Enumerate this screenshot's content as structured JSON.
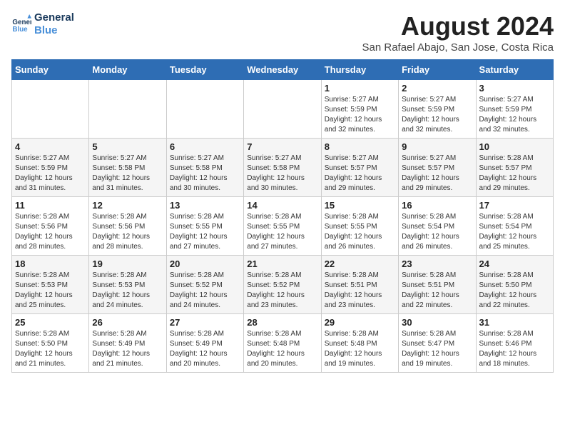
{
  "logo": {
    "line1": "General",
    "line2": "Blue"
  },
  "title": "August 2024",
  "subtitle": "San Rafael Abajo, San Jose, Costa Rica",
  "weekdays": [
    "Sunday",
    "Monday",
    "Tuesday",
    "Wednesday",
    "Thursday",
    "Friday",
    "Saturday"
  ],
  "weeks": [
    [
      {
        "day": "",
        "sunrise": "",
        "sunset": "",
        "daylight": ""
      },
      {
        "day": "",
        "sunrise": "",
        "sunset": "",
        "daylight": ""
      },
      {
        "day": "",
        "sunrise": "",
        "sunset": "",
        "daylight": ""
      },
      {
        "day": "",
        "sunrise": "",
        "sunset": "",
        "daylight": ""
      },
      {
        "day": "1",
        "sunrise": "5:27 AM",
        "sunset": "5:59 PM",
        "daylight": "12 hours and 32 minutes."
      },
      {
        "day": "2",
        "sunrise": "5:27 AM",
        "sunset": "5:59 PM",
        "daylight": "12 hours and 32 minutes."
      },
      {
        "day": "3",
        "sunrise": "5:27 AM",
        "sunset": "5:59 PM",
        "daylight": "12 hours and 32 minutes."
      }
    ],
    [
      {
        "day": "4",
        "sunrise": "5:27 AM",
        "sunset": "5:59 PM",
        "daylight": "12 hours and 31 minutes."
      },
      {
        "day": "5",
        "sunrise": "5:27 AM",
        "sunset": "5:58 PM",
        "daylight": "12 hours and 31 minutes."
      },
      {
        "day": "6",
        "sunrise": "5:27 AM",
        "sunset": "5:58 PM",
        "daylight": "12 hours and 30 minutes."
      },
      {
        "day": "7",
        "sunrise": "5:27 AM",
        "sunset": "5:58 PM",
        "daylight": "12 hours and 30 minutes."
      },
      {
        "day": "8",
        "sunrise": "5:27 AM",
        "sunset": "5:57 PM",
        "daylight": "12 hours and 29 minutes."
      },
      {
        "day": "9",
        "sunrise": "5:27 AM",
        "sunset": "5:57 PM",
        "daylight": "12 hours and 29 minutes."
      },
      {
        "day": "10",
        "sunrise": "5:28 AM",
        "sunset": "5:57 PM",
        "daylight": "12 hours and 29 minutes."
      }
    ],
    [
      {
        "day": "11",
        "sunrise": "5:28 AM",
        "sunset": "5:56 PM",
        "daylight": "12 hours and 28 minutes."
      },
      {
        "day": "12",
        "sunrise": "5:28 AM",
        "sunset": "5:56 PM",
        "daylight": "12 hours and 28 minutes."
      },
      {
        "day": "13",
        "sunrise": "5:28 AM",
        "sunset": "5:55 PM",
        "daylight": "12 hours and 27 minutes."
      },
      {
        "day": "14",
        "sunrise": "5:28 AM",
        "sunset": "5:55 PM",
        "daylight": "12 hours and 27 minutes."
      },
      {
        "day": "15",
        "sunrise": "5:28 AM",
        "sunset": "5:55 PM",
        "daylight": "12 hours and 26 minutes."
      },
      {
        "day": "16",
        "sunrise": "5:28 AM",
        "sunset": "5:54 PM",
        "daylight": "12 hours and 26 minutes."
      },
      {
        "day": "17",
        "sunrise": "5:28 AM",
        "sunset": "5:54 PM",
        "daylight": "12 hours and 25 minutes."
      }
    ],
    [
      {
        "day": "18",
        "sunrise": "5:28 AM",
        "sunset": "5:53 PM",
        "daylight": "12 hours and 25 minutes."
      },
      {
        "day": "19",
        "sunrise": "5:28 AM",
        "sunset": "5:53 PM",
        "daylight": "12 hours and 24 minutes."
      },
      {
        "day": "20",
        "sunrise": "5:28 AM",
        "sunset": "5:52 PM",
        "daylight": "12 hours and 24 minutes."
      },
      {
        "day": "21",
        "sunrise": "5:28 AM",
        "sunset": "5:52 PM",
        "daylight": "12 hours and 23 minutes."
      },
      {
        "day": "22",
        "sunrise": "5:28 AM",
        "sunset": "5:51 PM",
        "daylight": "12 hours and 23 minutes."
      },
      {
        "day": "23",
        "sunrise": "5:28 AM",
        "sunset": "5:51 PM",
        "daylight": "12 hours and 22 minutes."
      },
      {
        "day": "24",
        "sunrise": "5:28 AM",
        "sunset": "5:50 PM",
        "daylight": "12 hours and 22 minutes."
      }
    ],
    [
      {
        "day": "25",
        "sunrise": "5:28 AM",
        "sunset": "5:50 PM",
        "daylight": "12 hours and 21 minutes."
      },
      {
        "day": "26",
        "sunrise": "5:28 AM",
        "sunset": "5:49 PM",
        "daylight": "12 hours and 21 minutes."
      },
      {
        "day": "27",
        "sunrise": "5:28 AM",
        "sunset": "5:49 PM",
        "daylight": "12 hours and 20 minutes."
      },
      {
        "day": "28",
        "sunrise": "5:28 AM",
        "sunset": "5:48 PM",
        "daylight": "12 hours and 20 minutes."
      },
      {
        "day": "29",
        "sunrise": "5:28 AM",
        "sunset": "5:48 PM",
        "daylight": "12 hours and 19 minutes."
      },
      {
        "day": "30",
        "sunrise": "5:28 AM",
        "sunset": "5:47 PM",
        "daylight": "12 hours and 19 minutes."
      },
      {
        "day": "31",
        "sunrise": "5:28 AM",
        "sunset": "5:46 PM",
        "daylight": "12 hours and 18 minutes."
      }
    ]
  ],
  "labels": {
    "sunrise": "Sunrise:",
    "sunset": "Sunset:",
    "daylight": "Daylight:"
  }
}
